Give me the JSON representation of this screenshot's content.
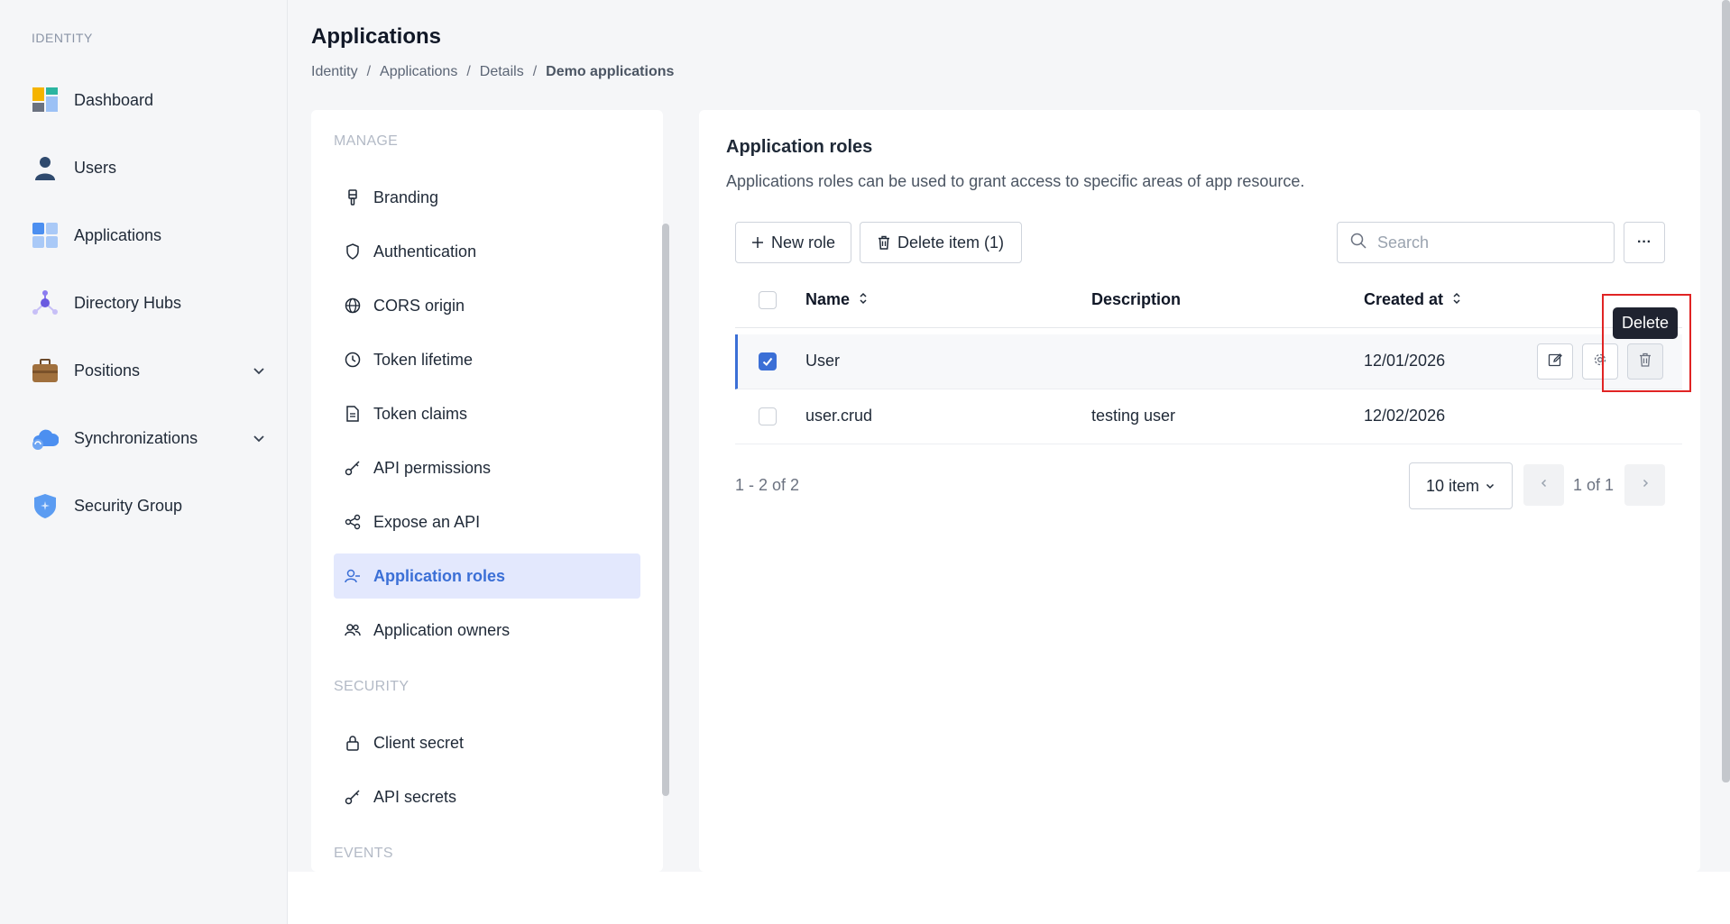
{
  "sidebar": {
    "heading": "IDENTITY",
    "items": [
      {
        "label": "Dashboard",
        "icon": "dashboard-icon"
      },
      {
        "label": "Users",
        "icon": "user-icon"
      },
      {
        "label": "Applications",
        "icon": "applications-icon"
      },
      {
        "label": "Directory Hubs",
        "icon": "hub-icon"
      },
      {
        "label": "Positions",
        "icon": "briefcase-icon",
        "expandable": true
      },
      {
        "label": "Synchronizations",
        "icon": "cloud-sync-icon",
        "expandable": true
      },
      {
        "label": "Security Group",
        "icon": "shield-icon"
      }
    ]
  },
  "header": {
    "title": "Applications",
    "breadcrumb": [
      "Identity",
      "Applications",
      "Details",
      "Demo applications"
    ],
    "separator": "/"
  },
  "settings": {
    "sections": [
      {
        "heading": "MANAGE"
      },
      {
        "heading": "SECURITY"
      },
      {
        "heading": "EVENTS"
      }
    ],
    "manage_items": [
      {
        "label": "Branding",
        "icon": "brush-icon"
      },
      {
        "label": "Authentication",
        "icon": "shield-outline-icon"
      },
      {
        "label": "CORS origin",
        "icon": "globe-icon"
      },
      {
        "label": "Token lifetime",
        "icon": "clock-icon"
      },
      {
        "label": "Token claims",
        "icon": "file-icon"
      },
      {
        "label": "API permissions",
        "icon": "key-icon"
      },
      {
        "label": "Expose an API",
        "icon": "share-icon"
      },
      {
        "label": "Application roles",
        "icon": "user-role-icon",
        "active": true
      },
      {
        "label": "Application owners",
        "icon": "users-icon"
      }
    ],
    "security_items": [
      {
        "label": "Client secret",
        "icon": "lock-icon"
      },
      {
        "label": "API secrets",
        "icon": "key-icon"
      }
    ]
  },
  "main": {
    "title": "Application roles",
    "description": "Applications roles can be used to grant access to specific areas of app resource.",
    "new_role_label": "New role",
    "delete_items_label": "Delete item (1)",
    "search_placeholder": "Search",
    "more_label": "···",
    "columns": {
      "name": "Name",
      "description": "Description",
      "created_at": "Created at"
    },
    "rows": [
      {
        "name": "User",
        "description": "",
        "created_at": "12/01/2026",
        "selected": true
      },
      {
        "name": "user.crud",
        "description": "testing user",
        "created_at": "12/02/2026",
        "selected": false
      }
    ],
    "tooltip": "Delete",
    "range_text": "1 - 2 of 2",
    "page_size": "10 item",
    "page_text": "1 of 1"
  },
  "colors": {
    "accent": "#3b6fd6",
    "active_bg": "#e3e8fd",
    "highlight": "#e02424"
  }
}
